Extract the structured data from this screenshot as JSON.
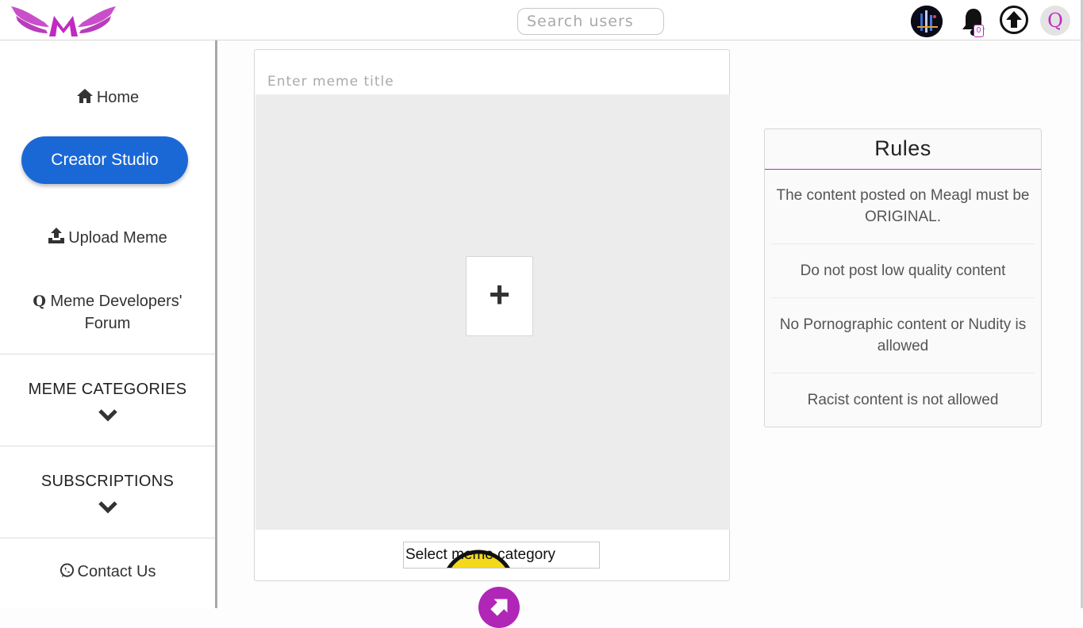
{
  "header": {
    "search_placeholder": "Search users",
    "notification_count": "0",
    "user_initial": "Q"
  },
  "sidebar": {
    "home": "Home",
    "creator_studio": "Creator Studio",
    "upload": "Upload Meme",
    "forum_line1": "Meme Developers'",
    "forum_line2": "Forum",
    "meme_categories": "MEME CATEGORIES",
    "subscriptions": "SUBSCRIPTIONS",
    "contact": "Contact Us"
  },
  "upload_card": {
    "title_placeholder": "Enter meme title",
    "add_symbol": "+",
    "category_label": "Select meme category"
  },
  "rules": {
    "title": "Rules",
    "items": [
      "The content posted on Meagl must be ORIGINAL.",
      "Do not post low quality content",
      "No Pornographic content or Nudity is allowed",
      "Racist content is not allowed"
    ]
  },
  "colors": {
    "brand": "#c229c2",
    "primary_button": "#1a68d6",
    "fab": "#b026b6"
  }
}
